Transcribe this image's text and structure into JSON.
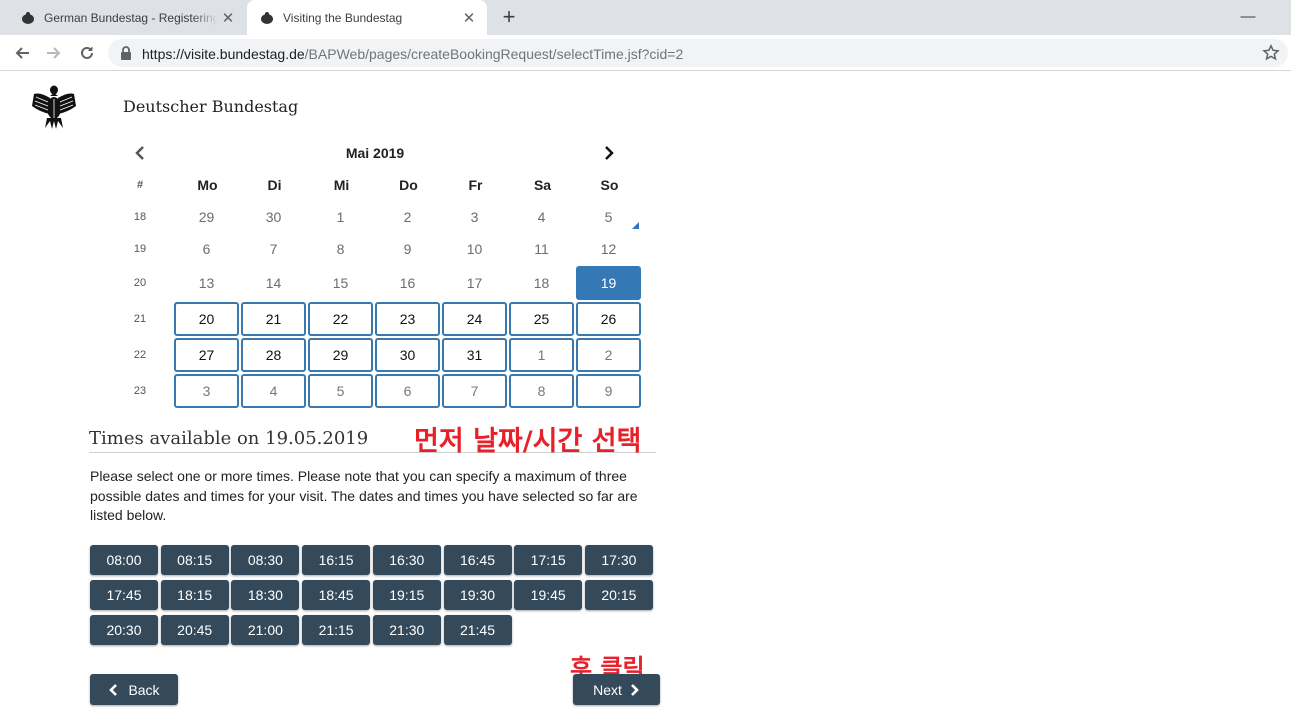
{
  "browser": {
    "tabs": [
      {
        "title": "German Bundestag - Registering",
        "icon": "eagle-favicon-icon",
        "active": false
      },
      {
        "title": "Visiting the Bundestag",
        "icon": "eagle-favicon-icon",
        "active": true
      }
    ],
    "close_glyph": "✕",
    "new_tab_glyph": "+",
    "minimize_glyph": "—",
    "url_host": "https://visite.bundestag.de",
    "url_path": "/BAPWeb/pages/createBookingRequest/selectTime.jsf?cid=2"
  },
  "site": {
    "name": "Deutscher Bundestag",
    "logo_icon": "federal-eagle-icon"
  },
  "calendar": {
    "month_label": "Mai 2019",
    "week_header": "#",
    "weekdays": [
      "Mo",
      "Di",
      "Mi",
      "Do",
      "Fr",
      "Sa",
      "So"
    ],
    "selected_color": "#3478b5",
    "rows": [
      {
        "week": "18",
        "days": [
          {
            "label": "29",
            "state": "disabled"
          },
          {
            "label": "30",
            "state": "disabled"
          },
          {
            "label": "1",
            "state": "disabled"
          },
          {
            "label": "2",
            "state": "disabled"
          },
          {
            "label": "3",
            "state": "disabled"
          },
          {
            "label": "4",
            "state": "disabled"
          },
          {
            "label": "5",
            "state": "disabled"
          }
        ]
      },
      {
        "week": "19",
        "days": [
          {
            "label": "6",
            "state": "disabled"
          },
          {
            "label": "7",
            "state": "disabled"
          },
          {
            "label": "8",
            "state": "disabled"
          },
          {
            "label": "9",
            "state": "disabled"
          },
          {
            "label": "10",
            "state": "disabled"
          },
          {
            "label": "11",
            "state": "disabled"
          },
          {
            "label": "12",
            "state": "disabled"
          }
        ]
      },
      {
        "week": "20",
        "days": [
          {
            "label": "13",
            "state": "disabled"
          },
          {
            "label": "14",
            "state": "disabled"
          },
          {
            "label": "15",
            "state": "disabled"
          },
          {
            "label": "16",
            "state": "disabled"
          },
          {
            "label": "17",
            "state": "disabled"
          },
          {
            "label": "18",
            "state": "disabled"
          },
          {
            "label": "19",
            "state": "selected"
          }
        ]
      },
      {
        "week": "21",
        "days": [
          {
            "label": "20",
            "state": "available"
          },
          {
            "label": "21",
            "state": "available"
          },
          {
            "label": "22",
            "state": "available"
          },
          {
            "label": "23",
            "state": "available"
          },
          {
            "label": "24",
            "state": "available"
          },
          {
            "label": "25",
            "state": "available"
          },
          {
            "label": "26",
            "state": "available"
          }
        ]
      },
      {
        "week": "22",
        "days": [
          {
            "label": "27",
            "state": "available"
          },
          {
            "label": "28",
            "state": "available"
          },
          {
            "label": "29",
            "state": "available"
          },
          {
            "label": "30",
            "state": "available"
          },
          {
            "label": "31",
            "state": "available"
          },
          {
            "label": "1",
            "state": "available-other"
          },
          {
            "label": "2",
            "state": "available-other"
          }
        ]
      },
      {
        "week": "23",
        "days": [
          {
            "label": "3",
            "state": "available-other"
          },
          {
            "label": "4",
            "state": "available-other"
          },
          {
            "label": "5",
            "state": "available-other"
          },
          {
            "label": "6",
            "state": "available-other"
          },
          {
            "label": "7",
            "state": "available-other"
          },
          {
            "label": "8",
            "state": "available-other"
          },
          {
            "label": "9",
            "state": "available-other"
          }
        ]
      }
    ]
  },
  "times": {
    "title": "Times available on 19.05.2019",
    "instructions": "Please select one or more times. Please note that you can specify a maximum of three possible dates and times for your visit. The dates and times you have selected so far are listed below.",
    "slots": [
      "08:00",
      "08:15",
      "08:30",
      "16:15",
      "16:30",
      "16:45",
      "17:15",
      "17:30",
      "17:45",
      "18:15",
      "18:30",
      "18:45",
      "19:15",
      "19:30",
      "19:45",
      "20:15",
      "20:30",
      "20:45",
      "21:00",
      "21:15",
      "21:30",
      "21:45"
    ],
    "button_color": "#344a5b"
  },
  "annotations": {
    "first": "먼저 날짜/시간 선택",
    "second": "후 클릭",
    "color": "#e8202a"
  },
  "actions": {
    "back_label": "Back",
    "next_label": "Next"
  }
}
